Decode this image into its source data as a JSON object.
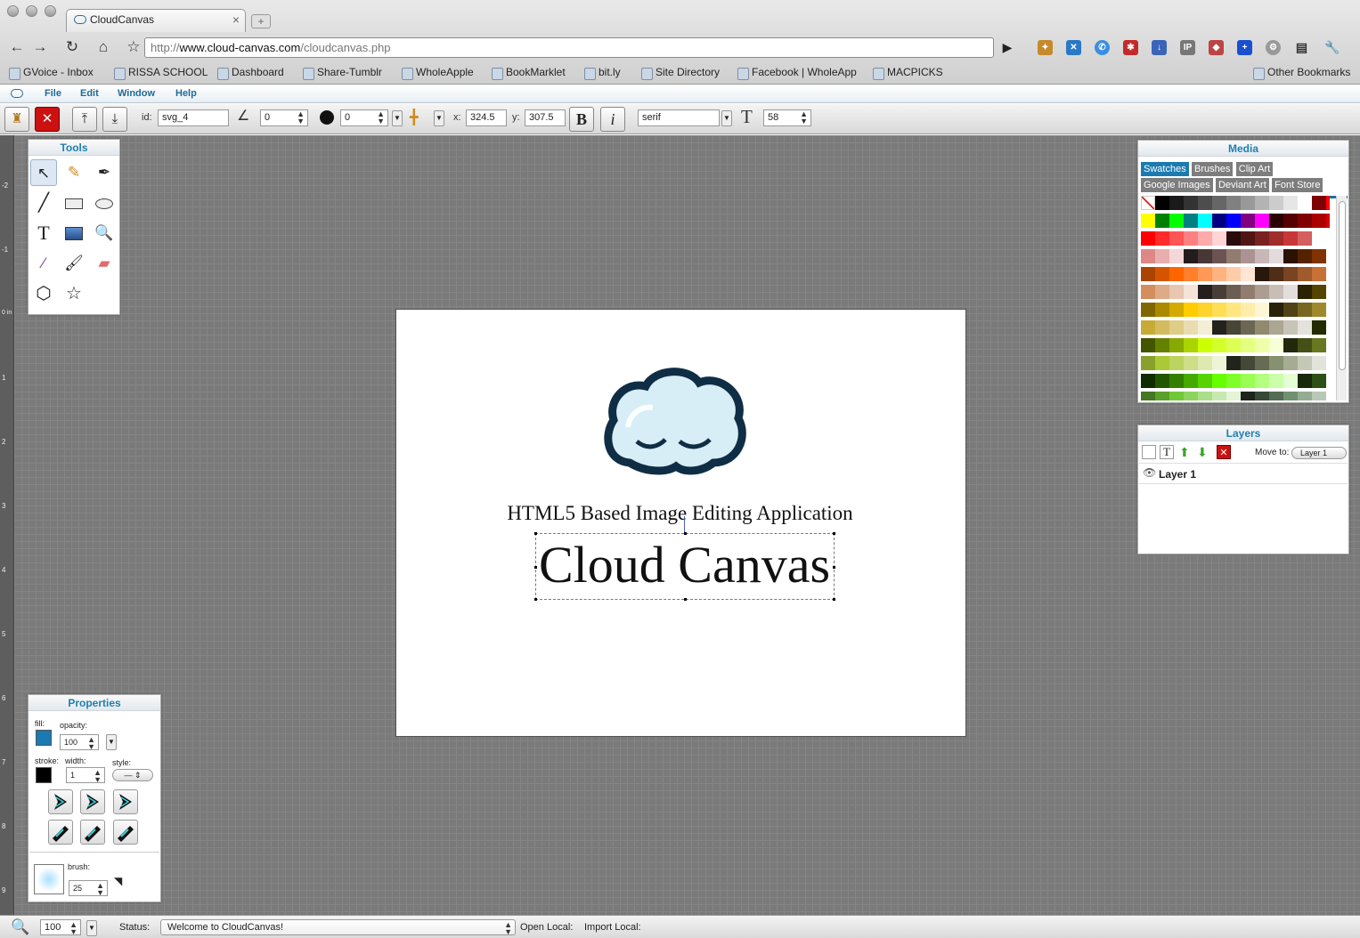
{
  "browser": {
    "tab_title": "CloudCanvas",
    "url_scheme": "http://",
    "url_host": "www.cloud-canvas.com",
    "url_path": "/cloudcanvas.php",
    "bookmarks": [
      "GVoice - Inbox",
      "RISSA SCHOOL",
      "Dashboard",
      "Share-Tumblr",
      "WholeApple",
      "BookMarklet",
      "bit.ly",
      "Site Directory",
      "Facebook | WholeApp",
      "MACPICKS"
    ],
    "other_bookmarks": "Other Bookmarks",
    "extensions": [
      "IP"
    ]
  },
  "menubar": {
    "items": [
      "File",
      "Edit",
      "Window",
      "Help"
    ]
  },
  "toolbar": {
    "id_label": "id:",
    "id_value": "svg_4",
    "angle_value": "0",
    "blur_value": "0",
    "x_label": "x:",
    "x_value": "324.5",
    "y_label": "y:",
    "y_value": "307.5",
    "bold_label": "B",
    "italic_label": "i",
    "font_family": "serif",
    "font_size": "58"
  },
  "tools_panel": {
    "title": "Tools",
    "text_tool_glyph": "T"
  },
  "ruler": {
    "ticks": [
      "-2",
      "-1",
      "0 in",
      "1",
      "2",
      "3",
      "4",
      "5",
      "6",
      "7",
      "8",
      "9"
    ]
  },
  "canvas": {
    "subtitle": "HTML5 Based Image Editing Application",
    "title": "Cloud Canvas"
  },
  "media_panel": {
    "title": "Media",
    "tabs": [
      "Swatches",
      "Brushes",
      "Clip Art",
      "Google Images",
      "Deviant Art",
      "Font Store"
    ],
    "active_tab": "Swatches",
    "swatch_rows": [
      [
        "none",
        "#000000",
        "#1a1a1a",
        "#333333",
        "#4d4d4d",
        "#666666",
        "#808080",
        "#999999",
        "#b3b3b3",
        "#cccccc",
        "#e6e6e6",
        "#ffffff",
        "#7f0000",
        "#ff0000",
        "#808000"
      ],
      [
        "#ffff00",
        "#008000",
        "#00ff00",
        "#008080",
        "#00ffff",
        "#000080",
        "#0000ff",
        "#800080",
        "#ff00ff",
        "#2b0000",
        "#550000",
        "#800000",
        "#aa0000",
        "#d40000"
      ],
      [
        "#ff0000",
        "#ff2a2a",
        "#ff5555",
        "#ff8080",
        "#ffaaaa",
        "#ffd5d5",
        "#280b0b",
        "#501616",
        "#782121",
        "#a02c2c",
        "#c83737",
        "#d35f5f"
      ],
      [
        "#de8787",
        "#e9afaf",
        "#f4d7d7",
        "#241c1c",
        "#483737",
        "#6c5353",
        "#917c6f",
        "#ac9393",
        "#c8b7b7",
        "#e3dbdb",
        "#2b1100",
        "#552200",
        "#803300"
      ],
      [
        "#aa4400",
        "#d45500",
        "#ff6600",
        "#ff7f2a",
        "#ff9955",
        "#ffb380",
        "#ffccaa",
        "#ffe6d5",
        "#28170b",
        "#502d16",
        "#784421",
        "#a05a2c",
        "#c87137"
      ],
      [
        "#d38d5f",
        "#deaa87",
        "#e9c6af",
        "#f4e3d7",
        "#241f1c",
        "#483e37",
        "#6c5d53",
        "#917c6f",
        "#ac9d93",
        "#c8beb7",
        "#e3dedb",
        "#2b2200",
        "#554400"
      ],
      [
        "#806600",
        "#aa8800",
        "#d4aa00",
        "#ffcc00",
        "#ffd42a",
        "#ffdd55",
        "#ffe680",
        "#ffeeaa",
        "#fff6d5",
        "#28220b",
        "#504416",
        "#786721",
        "#a0892c"
      ],
      [
        "#c8ab37",
        "#d3bc5f",
        "#decd87",
        "#e9ddaf",
        "#f4eed7",
        "#24221c",
        "#484537",
        "#6c6753",
        "#918a6f",
        "#aca793",
        "#c8c4b7",
        "#e3e2db",
        "#222b00"
      ],
      [
        "#445500",
        "#668000",
        "#88aa00",
        "#aad400",
        "#ccff00",
        "#d4ff2a",
        "#ddff55",
        "#e5ff80",
        "#eeffaa",
        "#f6ffd5",
        "#22280b",
        "#445016",
        "#677821"
      ],
      [
        "#89a02c",
        "#abc837",
        "#bcd35f",
        "#cdde87",
        "#dde9af",
        "#eef4d7",
        "#22241c",
        "#444837",
        "#666c53",
        "#88916f",
        "#a5ac93",
        "#c4c8b7",
        "#e2e3db"
      ],
      [
        "#112b00",
        "#225500",
        "#338000",
        "#44aa00",
        "#55d400",
        "#66ff00",
        "#7fff2a",
        "#99ff55",
        "#b3ff80",
        "#ccffaa",
        "#e5ffd5",
        "#17280b",
        "#2d5016"
      ],
      [
        "#447821",
        "#5aa02c",
        "#71c837",
        "#8dd35f",
        "#aade87",
        "#c6e9af",
        "#e3f4d7",
        "#1c241c",
        "#374837",
        "#536c53",
        "#6f916f",
        "#93ac93",
        "#b7c8b7"
      ]
    ]
  },
  "layers_panel": {
    "title": "Layers",
    "move_to_label": "Move to:",
    "move_to_value": "Layer 1",
    "layers": [
      "Layer 1"
    ]
  },
  "properties_panel": {
    "title": "Properties",
    "fill_label": "fill:",
    "opacity_label": "opacity:",
    "opacity_value": "100",
    "stroke_label": "stroke:",
    "width_label": "width:",
    "width_value": "1",
    "style_label": "style:",
    "brush_label": "brush:",
    "brush_value": "25",
    "fill_color": "#1a7ab3",
    "stroke_color": "#000000"
  },
  "statusbar": {
    "zoom_value": "100",
    "status_label": "Status:",
    "status_text": "Welcome to CloudCanvas!",
    "open_local": "Open Local:",
    "import_local": "Import Local:"
  }
}
